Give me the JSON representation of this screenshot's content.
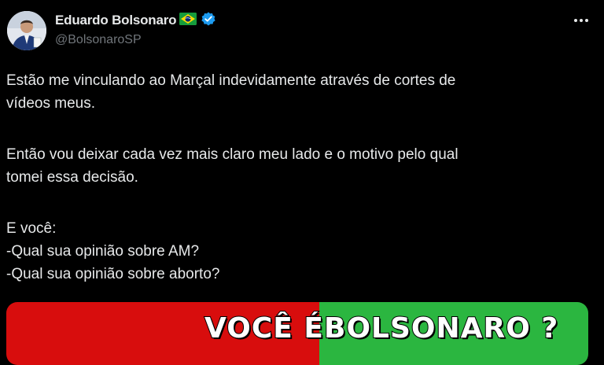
{
  "header": {
    "display_name": "Eduardo Bolsonaro",
    "handle": "@BolsonaroSP",
    "flag_icon": "brazil-flag-icon",
    "verified_icon": "verified-badge-icon",
    "more_icon": "more-options-icon",
    "verified_color": "#1d9bf0"
  },
  "tweet": {
    "line1": "Estão me vinculando ao Marçal indevidamente através de cortes de",
    "line2": "vídeos meus.",
    "line3": "Então vou deixar cada vez mais claro meu lado e o motivo pelo qual",
    "line4": "tomei essa decisão.",
    "line5": "E você:",
    "line6": "-Qual sua opinião sobre AM?",
    "line7": "-Qual sua opinião sobre aborto?"
  },
  "media": {
    "headline_part1": "VOCÊ É",
    "headline_part2": "BOLSONARO ?",
    "left_color": "#d80d0d",
    "right_color": "#2bb640"
  },
  "colors": {
    "background": "#000000",
    "text": "#e7e9ea",
    "muted": "#71767b"
  }
}
